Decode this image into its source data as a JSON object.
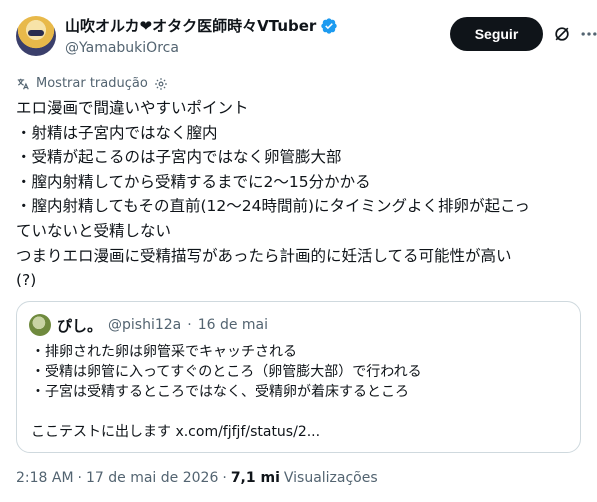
{
  "author": {
    "display_name": "山吹オルカ❤オタク医師時々VTuber",
    "handle": "@YamabukiOrca",
    "avatar_icon": "vtuber-avatar",
    "verified_color": "#1d9bf0"
  },
  "follow_label": "Seguir",
  "translate_label": "Mostrar tradução",
  "tweet_text": "エロ漫画で間違いやすいポイント\n・射精は子宮内ではなく膣内\n・受精が起こるのは子宮内ではなく卵管膨大部\n・膣内射精してから受精するまでに2〜15分かかる\n・膣内射精してもその直前(12〜24時間前)にタイミングよく排卵が起こっ\nていないと受精しない\nつまりエロ漫画に受精描写があったら計画的に妊活してる可能性が高い\n(?)",
  "quote": {
    "display_name": "ぴし。",
    "handle": "@pishi12a",
    "separator": "·",
    "date": "16 de mai",
    "body": "・排卵された卵は卵管采でキャッチされる\n・受精は卵管に入ってすぐのところ（卵管膨大部）で行われる\n・子宮は受精するところではなく、受精卵が着床するところ\n\nここテストに出します x.com/fjfjf/status/2..."
  },
  "footer": {
    "time": "2:18 AM",
    "separator": "·",
    "date": "17 de mai de 2026",
    "separator2": "·",
    "views_count": "7,1 mi",
    "views_label": "Visualizações"
  },
  "colors": {
    "text": "#0f1419",
    "muted": "#536471",
    "border": "#cfd9de",
    "button_bg": "#0f1419"
  }
}
